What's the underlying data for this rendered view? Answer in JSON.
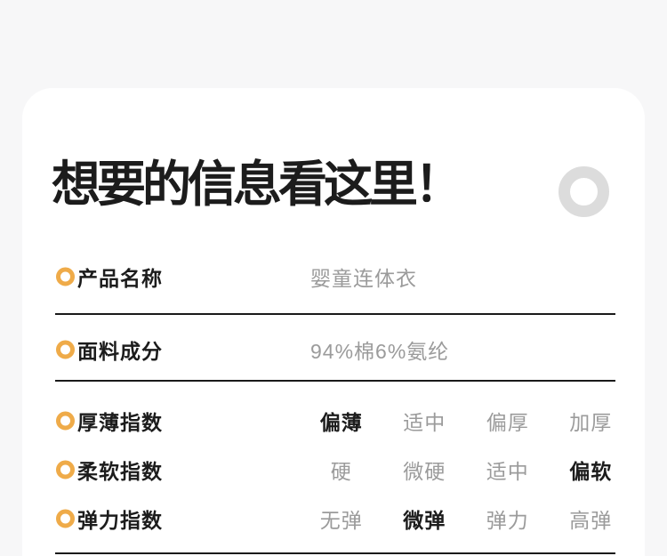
{
  "page": {
    "background_color": "#f7f7f8",
    "card_background": "#ffffff"
  },
  "colors": {
    "accent_ring": "#efab49",
    "decorative_ring_gray": "#dcdcdc",
    "text_primary": "#1c1c1c",
    "text_muted": "#9b9b9b",
    "divider": "#1a1a1a"
  },
  "header": {
    "title": "想要的信息看这里！",
    "decoration_icon": "gray-donut-ring"
  },
  "info_rows": [
    {
      "label": "产品名称",
      "value": "婴童连体衣"
    },
    {
      "label": "面料成分",
      "value": "94%棉6%氨纶"
    }
  ],
  "index_rows": [
    {
      "label": "厚薄指数",
      "options": [
        "偏薄",
        "适中",
        "偏厚",
        "加厚"
      ],
      "selected": 0
    },
    {
      "label": "柔软指数",
      "options": [
        "硬",
        "微硬",
        "适中",
        "偏软"
      ],
      "selected": 3
    },
    {
      "label": "弹力指数",
      "options": [
        "无弹",
        "微弹",
        "弹力",
        "高弹"
      ],
      "selected": 1
    }
  ]
}
